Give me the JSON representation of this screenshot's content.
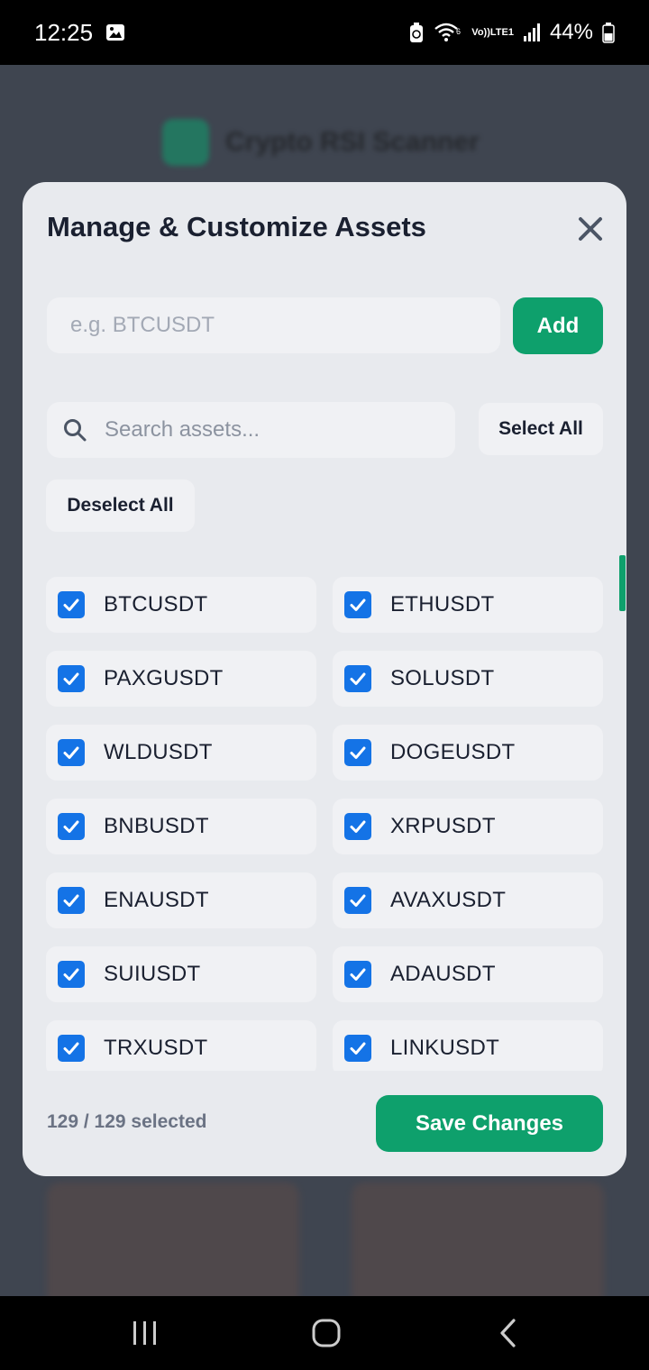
{
  "status_bar": {
    "time": "12:25",
    "battery": "44%",
    "network": "LTE1"
  },
  "background_app": {
    "title": "Crypto RSI Scanner"
  },
  "modal": {
    "title": "Manage & Customize Assets",
    "add_placeholder": "e.g. BTCUSDT",
    "add_label": "Add",
    "search_placeholder": "Search assets...",
    "select_all_label": "Select All",
    "deselect_all_label": "Deselect All",
    "assets": [
      {
        "symbol": "BTCUSDT",
        "checked": true
      },
      {
        "symbol": "ETHUSDT",
        "checked": true
      },
      {
        "symbol": "PAXGUSDT",
        "checked": true
      },
      {
        "symbol": "SOLUSDT",
        "checked": true
      },
      {
        "symbol": "WLDUSDT",
        "checked": true
      },
      {
        "symbol": "DOGEUSDT",
        "checked": true
      },
      {
        "symbol": "BNBUSDT",
        "checked": true
      },
      {
        "symbol": "XRPUSDT",
        "checked": true
      },
      {
        "symbol": "ENAUSDT",
        "checked": true
      },
      {
        "symbol": "AVAXUSDT",
        "checked": true
      },
      {
        "symbol": "SUIUSDT",
        "checked": true
      },
      {
        "symbol": "ADAUSDT",
        "checked": true
      },
      {
        "symbol": "TRXUSDT",
        "checked": true
      },
      {
        "symbol": "LINKUSDT",
        "checked": true
      }
    ],
    "selected_count": "129 / 129 selected",
    "save_label": "Save Changes"
  },
  "colors": {
    "accent_green": "#0ea06c",
    "checkbox_blue": "#1473e6"
  }
}
